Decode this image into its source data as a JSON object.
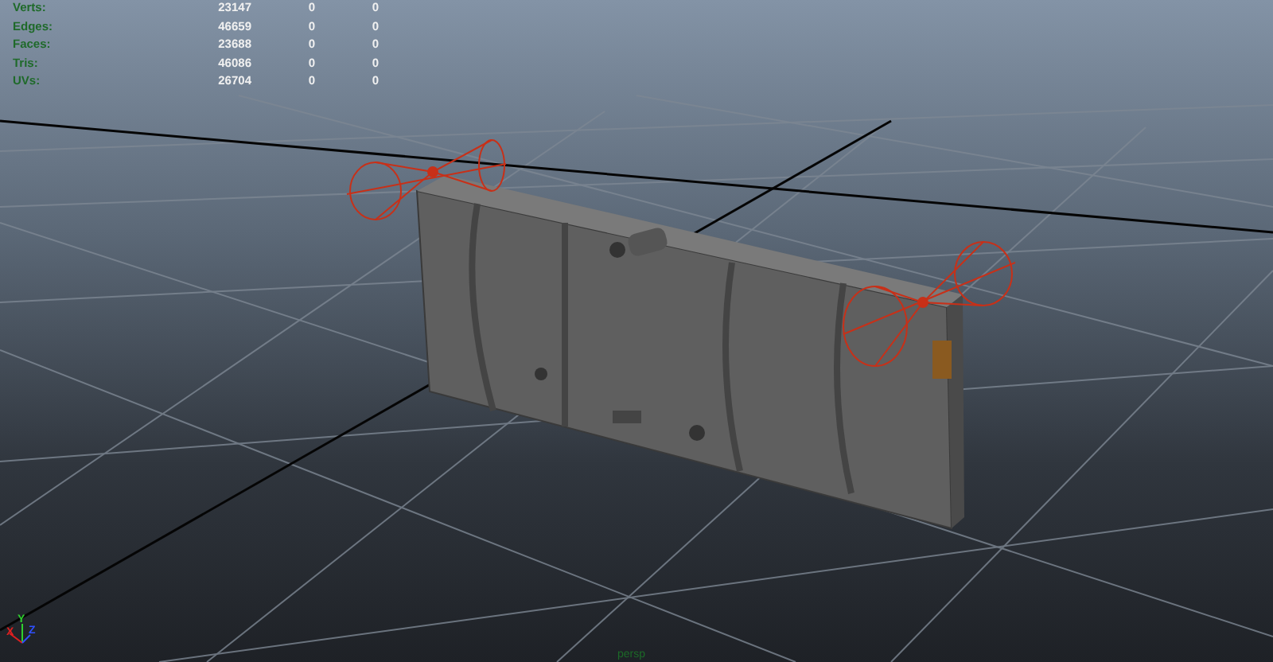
{
  "hud": {
    "rows": [
      {
        "label": "Verts:",
        "values": [
          "23147",
          "0",
          "0"
        ]
      },
      {
        "label": "Edges:",
        "values": [
          "46659",
          "0",
          "0"
        ]
      },
      {
        "label": "Faces:",
        "values": [
          "23688",
          "0",
          "0"
        ]
      },
      {
        "label": "Tris:",
        "values": [
          "46086",
          "0",
          "0"
        ]
      },
      {
        "label": "UVs:",
        "values": [
          "26704",
          "0",
          "0"
        ]
      }
    ]
  },
  "axis_gizmo": {
    "x": "X",
    "y": "Y",
    "z": "Z"
  },
  "camera_label": "persp"
}
